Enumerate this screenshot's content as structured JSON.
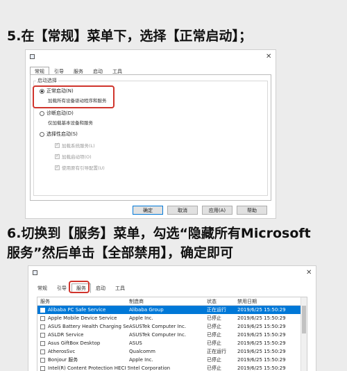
{
  "step5": {
    "caption": "5.在【常规】菜单下，选择【正常启动】；"
  },
  "dialog1": {
    "tabs": [
      "常规",
      "引导",
      "服务",
      "启动",
      "工具"
    ],
    "group_title": "启动选择",
    "normal_startup": {
      "label": "正常启动(N)",
      "desc": "加载所有设备驱动程序和服务",
      "selected": true
    },
    "diagnostic_startup": {
      "label": "诊断启动(D)",
      "desc": "仅加载基本设备和服务",
      "selected": false
    },
    "selective_startup": {
      "label": "选择性启动(S)",
      "selected": false,
      "options": [
        {
          "label": "加载系统服务(L)",
          "checked": true
        },
        {
          "label": "加载启动项(O)",
          "checked": true
        },
        {
          "label": "使用原有引导配置(U)",
          "checked": true
        }
      ]
    },
    "buttons": {
      "ok": "确定",
      "cancel": "取消",
      "apply": "应用(A)",
      "help": "帮助"
    }
  },
  "step6": {
    "caption_line1": "6.切换到【服务】菜单，勾选“隐藏所有Microsoft",
    "caption_line2": "服务”然后单击【全部禁用】，确定即可"
  },
  "dialog2": {
    "tabs": [
      "常规",
      "引导",
      "服务",
      "启动",
      "工具"
    ],
    "active_tab": "服务",
    "columns": {
      "service": "服务",
      "maker": "制造商",
      "status": "状态",
      "disabled_date": "禁用日期"
    },
    "rows": [
      {
        "service": "Alibaba PC Safe Service",
        "maker": "Alibaba Group",
        "status": "正在运行",
        "date": "2019/6/25 15:50:29",
        "selected": true
      },
      {
        "service": "Apple Mobile Device Service",
        "maker": "Apple Inc.",
        "status": "已停止",
        "date": "2019/6/25 15:50:29",
        "selected": false
      },
      {
        "service": "ASUS Battery Health Charging Ser...",
        "maker": "ASUSTek Computer Inc.",
        "status": "已停止",
        "date": "2019/6/25 15:50:29",
        "selected": false
      },
      {
        "service": "ASLDR Service",
        "maker": "ASUSTek Computer Inc.",
        "status": "已停止",
        "date": "2019/6/25 15:50:29",
        "selected": false
      },
      {
        "service": "Asus GiftBox Desktop",
        "maker": "ASUS",
        "status": "已停止",
        "date": "2019/6/25 15:50:29",
        "selected": false
      },
      {
        "service": "AtherosSvc",
        "maker": "Qualcomm",
        "status": "正在运行",
        "date": "2019/6/25 15:50:29",
        "selected": false
      },
      {
        "service": "Bonjour 服务",
        "maker": "Apple Inc.",
        "status": "已停止",
        "date": "2019/6/25 15:50:29",
        "selected": false
      },
      {
        "service": "Intel(R) Content Protection HECI S...",
        "maker": "Intel Corporation",
        "status": "已停止",
        "date": "2019/6/25 15:50:29",
        "selected": false
      }
    ]
  },
  "colors": {
    "highlight": "#d0342c",
    "selection": "#0078d7"
  },
  "icons": {
    "close": "close-icon",
    "app": "msconfig-app-icon"
  }
}
